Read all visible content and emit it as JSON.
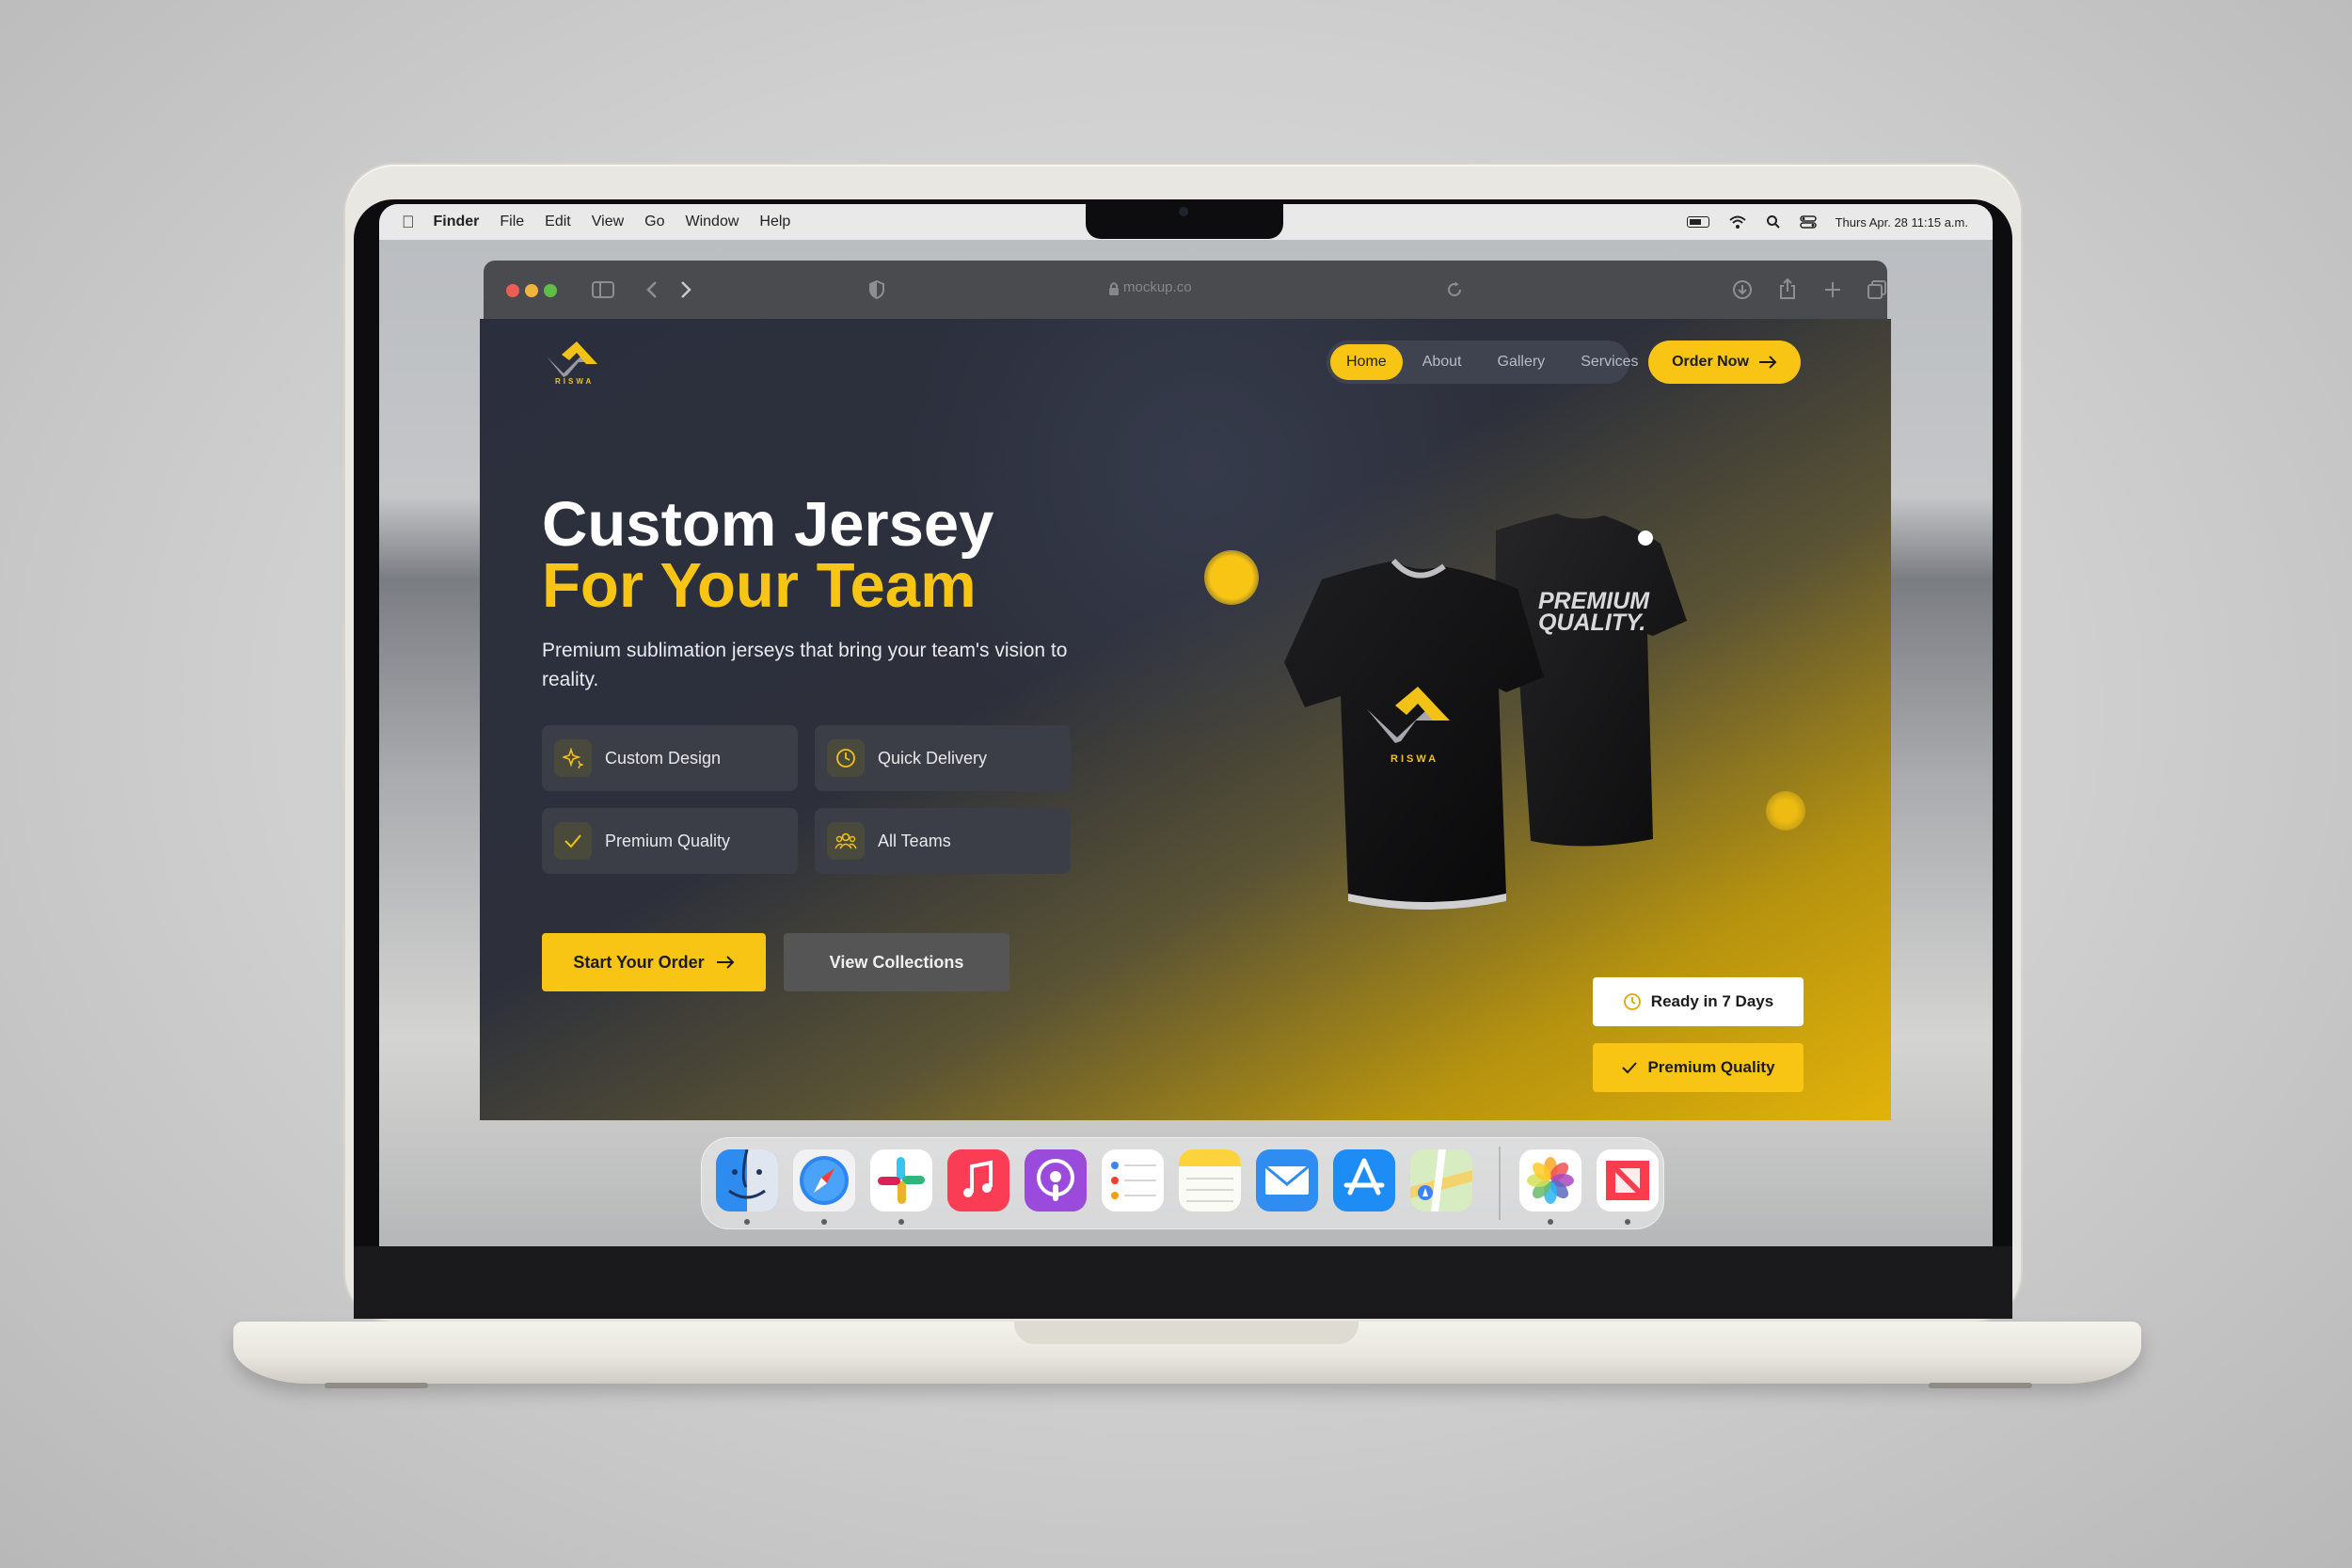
{
  "menubar": {
    "app_name": "Finder",
    "items": [
      "File",
      "Edit",
      "View",
      "Go",
      "Window",
      "Help"
    ],
    "datetime": "Thurs Apr. 28 11:15 a.m."
  },
  "browser": {
    "url": "mockup.co"
  },
  "site": {
    "brand": "RISWA",
    "nav": [
      "Home",
      "About",
      "Gallery",
      "Services"
    ],
    "nav_active": "Home",
    "order_now": "Order Now",
    "headline_line1": "Custom Jersey",
    "headline_line2": "For Your Team",
    "subheadline": "Premium sublimation jerseys that bring your team's vision to reality.",
    "features": [
      {
        "label": "Custom Design",
        "icon": "sparkle-icon"
      },
      {
        "label": "Quick Delivery",
        "icon": "clock-icon"
      },
      {
        "label": "Premium Quality",
        "icon": "check-icon"
      },
      {
        "label": "All Teams",
        "icon": "team-icon"
      }
    ],
    "cta_primary": "Start Your Order",
    "cta_secondary": "View Collections",
    "jersey_back_text_1": "PREMIUM",
    "jersey_back_text_2": "QUALITY.",
    "jersey_front_brand": "RISWA",
    "badge_ready": "Ready in 7 Days",
    "badge_quality": "Premium Quality"
  },
  "dock": {
    "apps": [
      "Finder",
      "Safari",
      "Slack",
      "Music",
      "Podcasts",
      "Reminders",
      "Notes",
      "Mail",
      "App Store",
      "Maps",
      "Photos",
      "News"
    ]
  },
  "colors": {
    "accent": "#f8c514",
    "hero_dark": "#2b2f3d"
  }
}
